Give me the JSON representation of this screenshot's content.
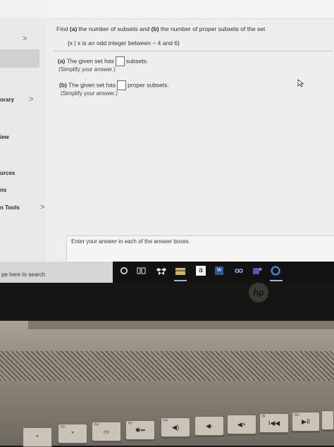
{
  "sidebar": {
    "items": [
      {
        "label": "orary"
      },
      {
        "label": "iew"
      },
      {
        "label": "urces"
      },
      {
        "label": "ns"
      },
      {
        "label": "n Tools"
      }
    ],
    "chevron": ">"
  },
  "problem": {
    "question_prefix": "Find ",
    "question_a": "(a)",
    "question_mid": " the number of subsets and ",
    "question_b": "(b)",
    "question_suffix": " the number of proper subsets of the set",
    "set_definition": "{x | x is an odd integer between  − 4 and 6}",
    "part_a_label": "(a)",
    "part_a_text": " The given set has",
    "part_a_unit": "subsets.",
    "part_a_hint": "(Simplify your answer.)",
    "part_b_label": "(b)",
    "part_b_text": " The given set has",
    "part_b_unit": "proper subsets.",
    "part_b_hint": "(Simplify your answer.)",
    "footer_text": "Enter your answer in each of the answer boxes."
  },
  "taskbar": {
    "search_placeholder": "pe here to search",
    "icons": [
      "cortana-icon",
      "task-view-icon",
      "dropbox-icon",
      "file-explorer-icon",
      "amazon-icon",
      "word-icon",
      "infinity-app-icon",
      "teams-icon",
      "edge-icon"
    ],
    "amazon_glyph": "a",
    "word_glyph": "W"
  },
  "laptop": {
    "brand": "hp",
    "keys": [
      {
        "num": "",
        "glyph": "*"
      },
      {
        "num": "F3",
        "glyph": "*"
      },
      {
        "num": "F4",
        "glyph": "▭"
      },
      {
        "num": "F5",
        "glyph": "✱▪▪"
      },
      {
        "num": "F6",
        "glyph": "◀)"
      },
      {
        "num": "",
        "glyph": "◀-"
      },
      {
        "num": "",
        "glyph": "◀+"
      },
      {
        "num": "f9",
        "glyph": "I◀◀"
      },
      {
        "num": "f10",
        "glyph": "▶II"
      },
      {
        "num": "",
        "glyph": ""
      }
    ]
  }
}
